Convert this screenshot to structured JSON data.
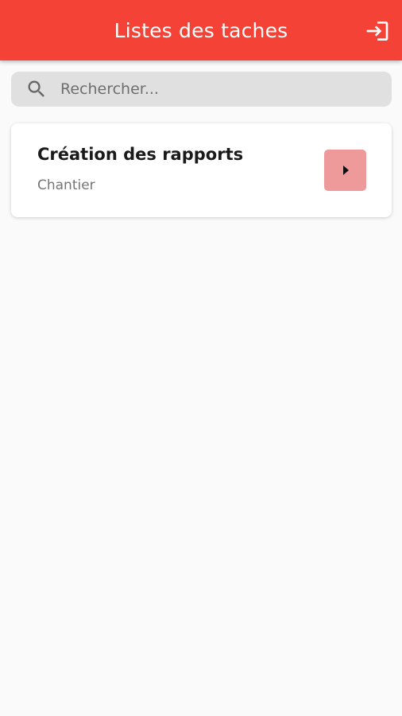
{
  "appbar": {
    "title": "Listes des taches",
    "background_color": "#f44336",
    "logout_icon": "login-icon"
  },
  "search": {
    "placeholder": "Rechercher...",
    "value": "",
    "icon": "search-icon"
  },
  "tasks": [
    {
      "title": "Création des rapports",
      "subtitle": "Chantier",
      "action_icon": "play-arrow-icon",
      "action_color": "#ef9a9a"
    }
  ]
}
